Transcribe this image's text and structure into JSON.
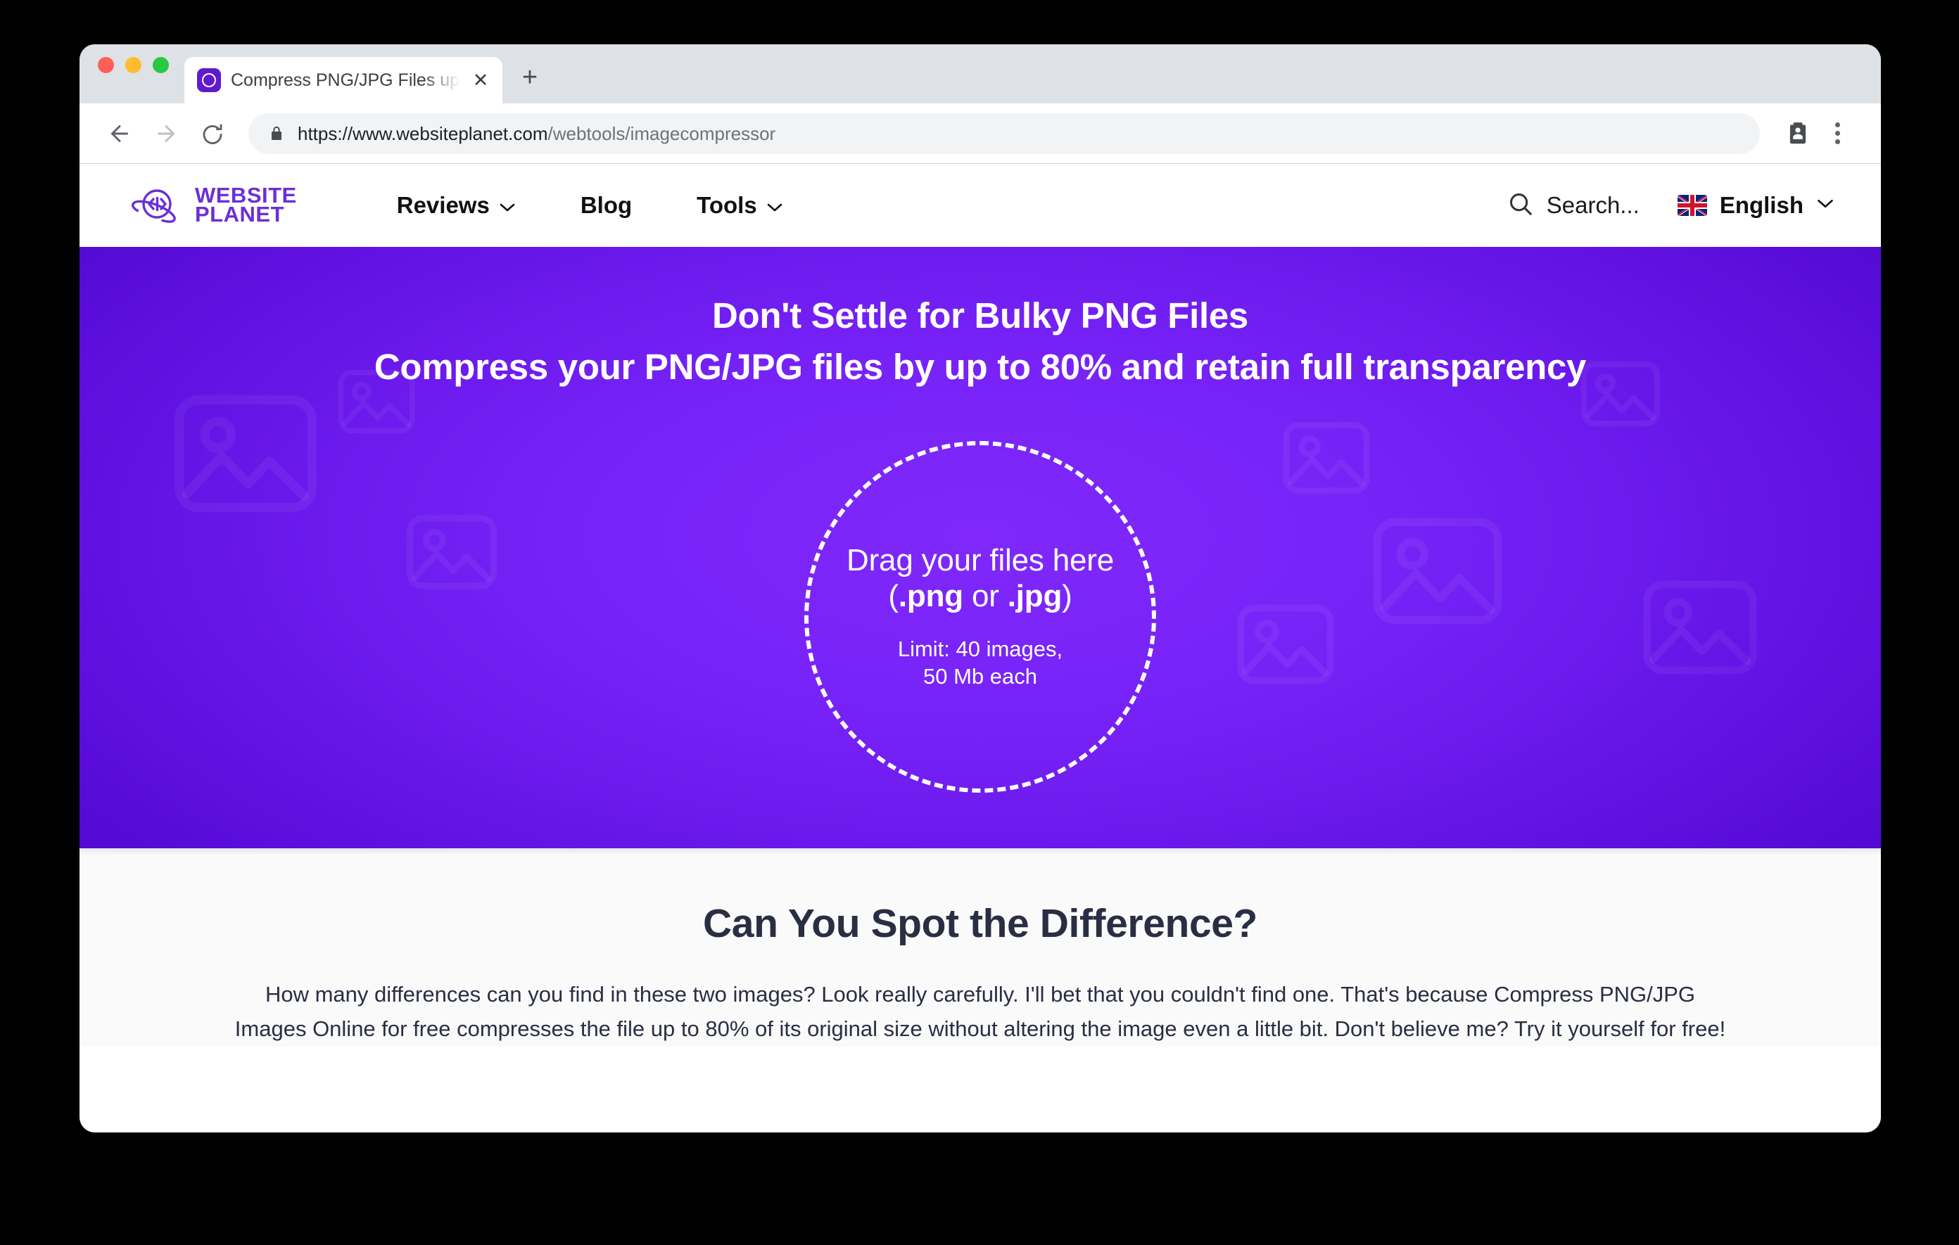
{
  "browser": {
    "tab": {
      "title": "Compress PNG/JPG Files up to",
      "close_label": "✕",
      "favicon_name": "websiteplanet-favicon"
    },
    "new_tab_label": "+",
    "toolbar": {
      "back_label": "←",
      "forward_label": "→",
      "reload_label": "↻",
      "url_domain": "https://www.websiteplanet.com",
      "url_path": "/webtools/imagecompressor"
    }
  },
  "site_header": {
    "logo": {
      "line1": "WEBSITE",
      "line2": "PLANET"
    },
    "nav": [
      {
        "label": "Reviews",
        "caret": "⌄",
        "has_caret": true
      },
      {
        "label": "Blog",
        "caret": "",
        "has_caret": false
      },
      {
        "label": "Tools",
        "caret": "⌄",
        "has_caret": true
      }
    ],
    "search": {
      "label": "Search..."
    },
    "language": {
      "label": "English",
      "caret": "⌄",
      "flag": "uk-flag"
    }
  },
  "hero": {
    "title": "Don't Settle for Bulky PNG Files",
    "subtitle": "Compress your PNG/JPG files by up to 80% and retain full transparency",
    "dropzone": {
      "line1": "Drag your files here",
      "line2_open": "(",
      "line2_png": ".png",
      "line2_or": " or ",
      "line2_jpg": ".jpg",
      "line2_close": ")",
      "limit_line1": "Limit: 40 images,",
      "limit_line2": "50 Mb each"
    },
    "colors": {
      "gradient_center": "#8028fb",
      "gradient_edge": "#5409d4"
    }
  },
  "lower": {
    "title": "Can You Spot the Difference?",
    "paragraph": "How many differences can you find in these two images? Look really carefully. I'll bet that you couldn't find one. That's because Compress PNG/JPG Images Online for free compresses the file up to 80% of its original size without altering the image even a little bit. Don't believe me? Try it yourself for free!"
  },
  "theme": {
    "brand_purple": "#6b2fd6",
    "lower_bg": "#fafafa",
    "heading_navy": "#2a2e43"
  }
}
